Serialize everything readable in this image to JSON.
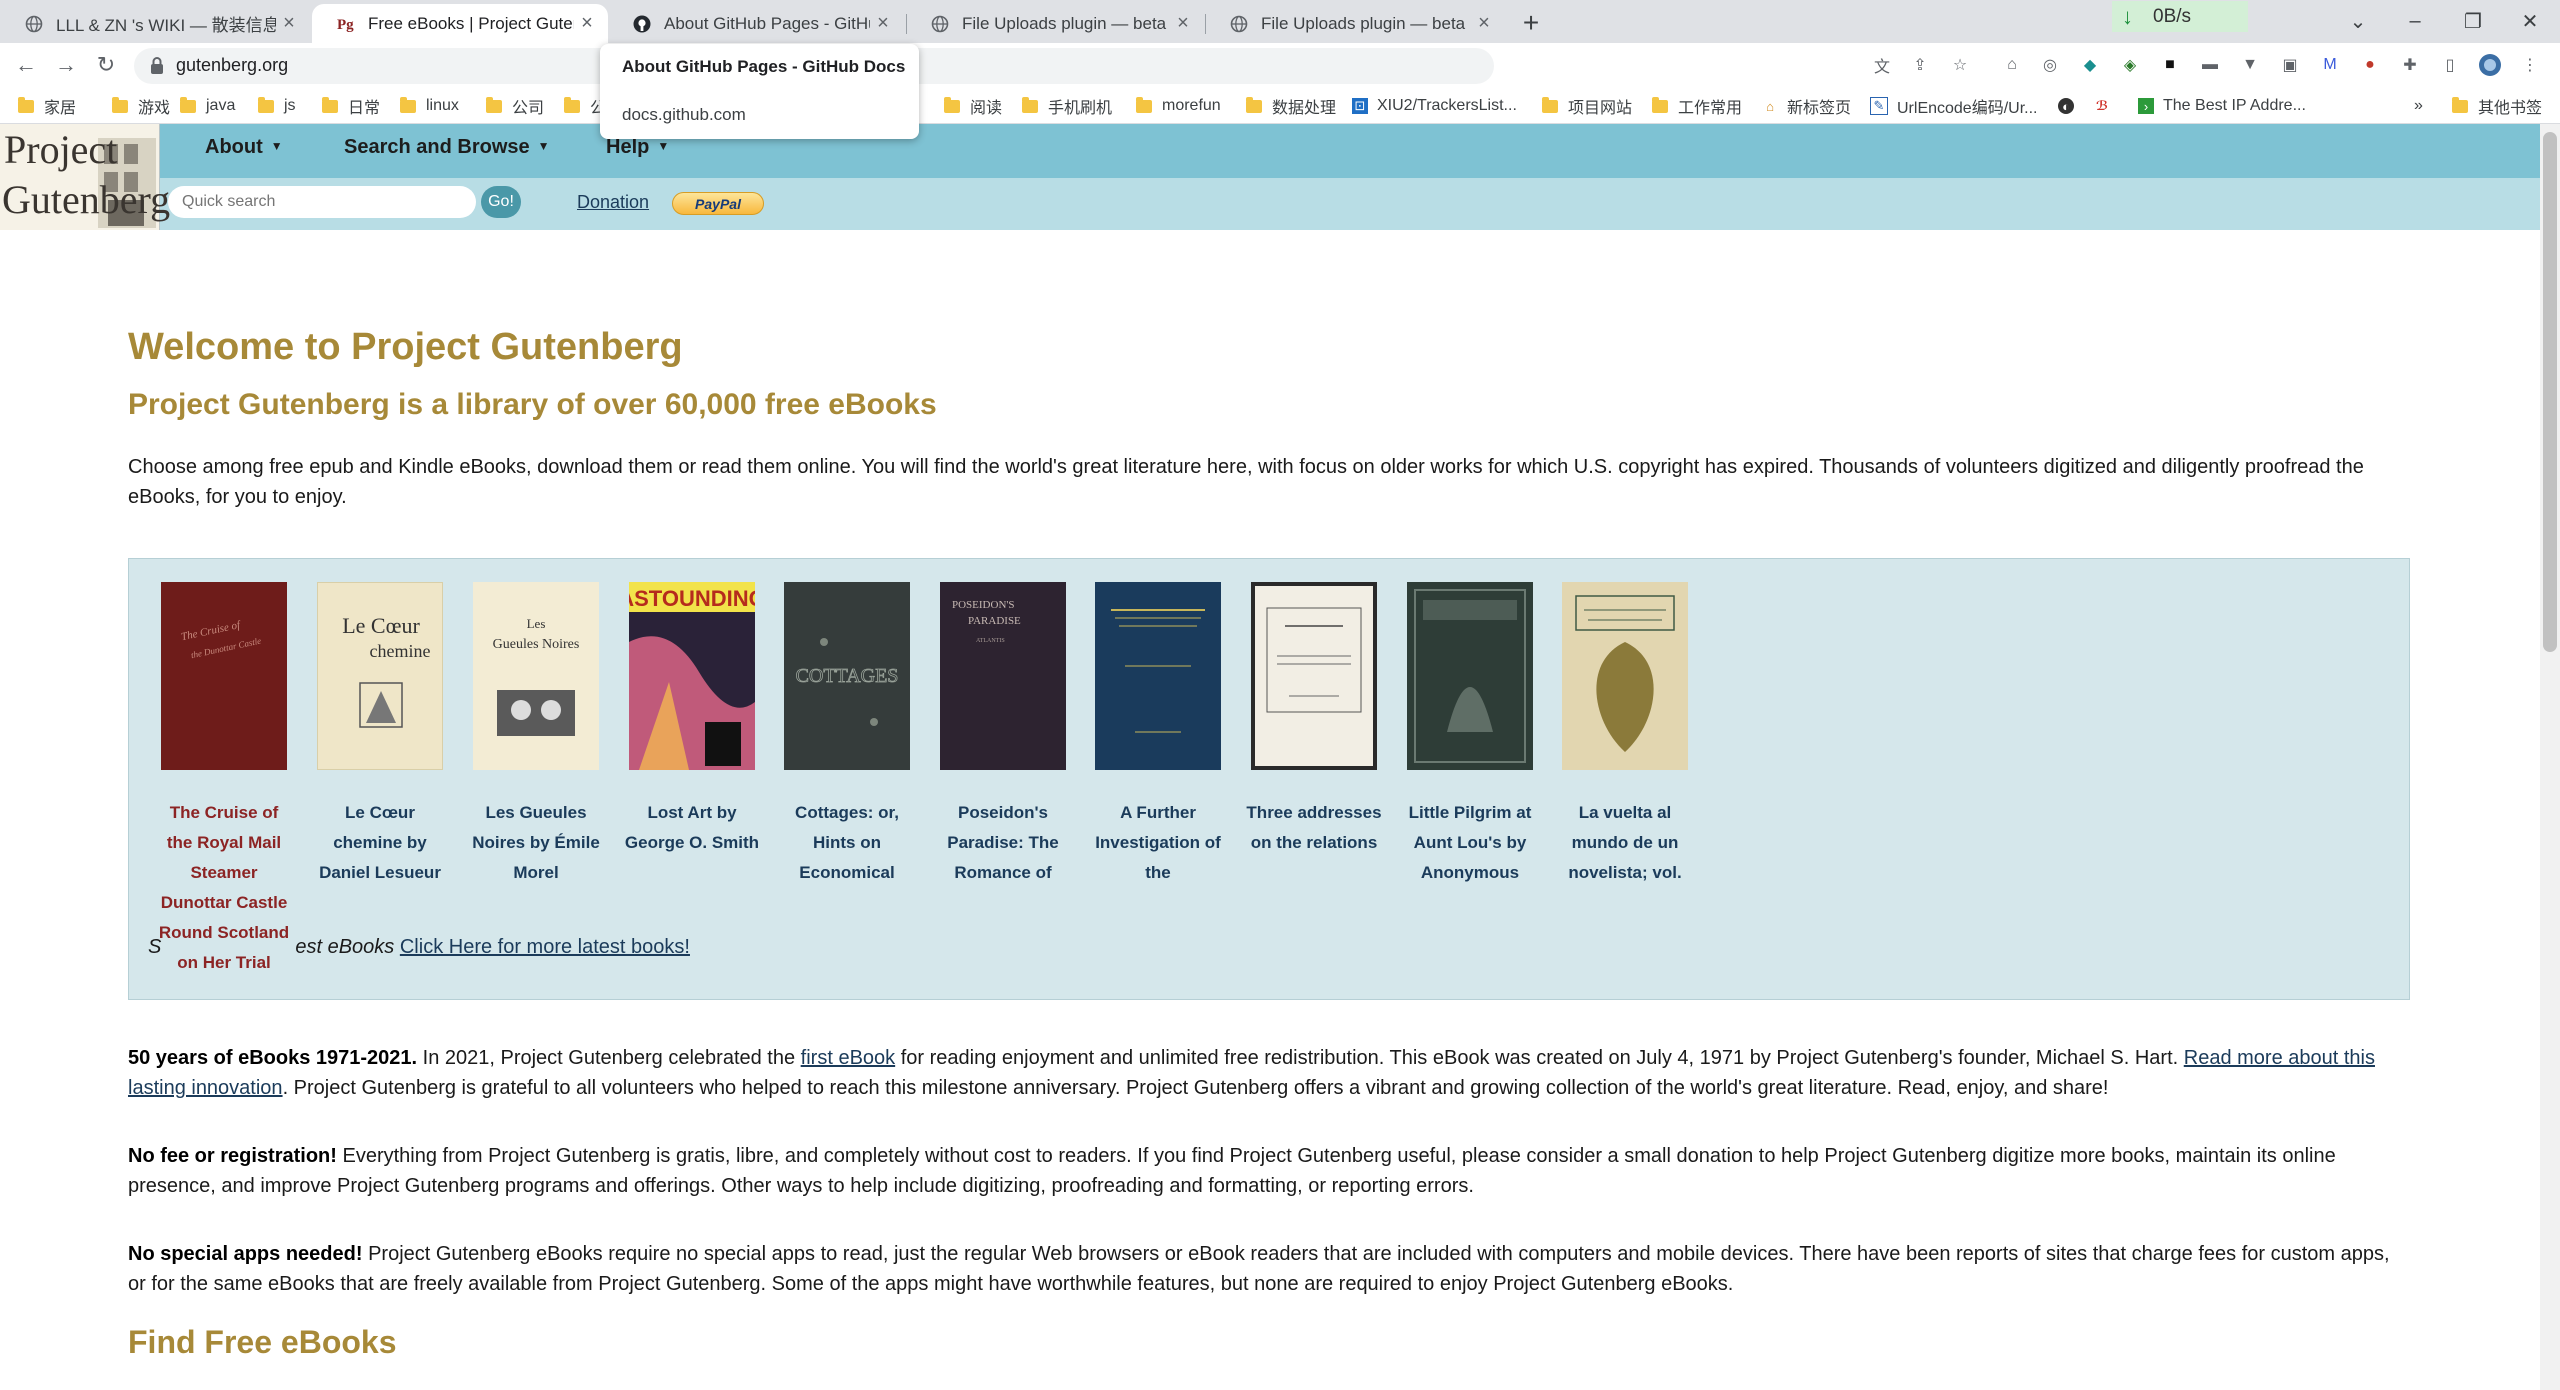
{
  "browser": {
    "tabs": [
      {
        "title": "LLL & ZN 's WIKI — 散装信息系",
        "icon": "globe-icon"
      },
      {
        "title": "Free eBooks | Project Gutenbe",
        "icon": "gutenberg-icon"
      },
      {
        "title": "About GitHub Pages - GitHub",
        "icon": "github-icon"
      },
      {
        "title": "File Uploads plugin — beta",
        "icon": "globe-icon"
      },
      {
        "title": "File Uploads plugin — beta",
        "icon": "globe-icon"
      }
    ],
    "net_speed": "0B/s",
    "url": "gutenberg.org",
    "bookmarks": [
      "家居",
      "游戏",
      "java",
      "js",
      "日常",
      "linux",
      "公司",
      "公",
      "阅读",
      "手机刷机",
      "morefun",
      "数据处理",
      "XIU2/TrackersList...",
      "项目网站",
      "工作常用",
      "新标签页",
      "UrlEncode编码/Ur...",
      "",
      "The Best IP Addre...",
      "其他书签"
    ],
    "tooltip": {
      "title": "About GitHub Pages - GitHub Docs",
      "url": "docs.github.com"
    }
  },
  "site": {
    "logo_line1": "Project",
    "logo_line2": "Gutenberg",
    "menu": [
      "About",
      "Search and Browse",
      "Help"
    ],
    "search_placeholder": "Quick search",
    "go_label": "Go!",
    "donation_label": "Donation",
    "paypal_label": "PayPal"
  },
  "main": {
    "title": "Welcome to Project Gutenberg",
    "subtitle": "Project Gutenberg is a library of over 60,000 free eBooks",
    "intro": "Choose among free epub and Kindle eBooks, download them or read them online. You will find the world's great literature here, with focus on older works for which U.S. copyright has expired. Thousands of volunteers digitized and diligently proofread the eBooks, for you to enjoy.",
    "books": [
      {
        "title": "The Cruise of the Royal Mail Steamer Dunottar Castle Round Scotland on Her Trial",
        "cover_color": "#6e1c1a"
      },
      {
        "title": "Le Cœur chemine by Daniel Lesueur",
        "cover_color": "#efe6c8"
      },
      {
        "title": "Les Gueules Noires by Émile Morel",
        "cover_color": "#f3ecd4"
      },
      {
        "title": "Lost Art by George O. Smith",
        "cover_color": "#2a2238"
      },
      {
        "title": "Cottages: or, Hints on Economical",
        "cover_color": "#353c3b"
      },
      {
        "title": "Poseidon's Paradise: The Romance of",
        "cover_color": "#2d2330"
      },
      {
        "title": "A Further Investigation of the",
        "cover_color": "#1a3b5c"
      },
      {
        "title": "Three addresses on the relations",
        "cover_color": "#f2eee4"
      },
      {
        "title": "Little Pilgrim at Aunt Lou's by Anonymous",
        "cover_color": "#2e3d37"
      },
      {
        "title": "La vuelta al mundo de un novelista; vol.",
        "cover_color": "#e2d6b0"
      }
    ],
    "latest_prefix": "S",
    "latest_text": "est eBooks",
    "latest_link": "Click Here for more latest books!",
    "p1_bold": "50 years of eBooks 1971-2021.",
    "p1_a": " In 2021, Project Gutenberg celebrated the ",
    "p1_link1": "first eBook",
    "p1_b": " for reading enjoyment and unlimited free redistribution. This eBook was created on July 4, 1971 by Project Gutenberg's founder, Michael S. Hart. ",
    "p1_link2": "Read more about this lasting innovation",
    "p1_c": ". Project Gutenberg is grateful to all volunteers who helped to reach this milestone anniversary. Project Gutenberg offers a vibrant and growing collection of the world's great literature. Read, enjoy, and share!",
    "p2_bold": "No fee or registration!",
    "p2_text": " Everything from Project Gutenberg is gratis, libre, and completely without cost to readers. If you find Project Gutenberg useful, please consider a small donation to help Project Gutenberg digitize more books, maintain its online presence, and improve Project Gutenberg programs and offerings. Other ways to help include digitizing, proofreading and formatting, or reporting errors.",
    "p3_bold": "No special apps needed!",
    "p3_text": " Project Gutenberg eBooks require no special apps to read, just the regular Web browsers or eBook readers that are included with computers and mobile devices. There have been reports of sites that charge fees for custom apps, or for the same eBooks that are freely available from Project Gutenberg. Some of the apps might have worthwhile features, but none are required to enjoy Project Gutenberg eBooks.",
    "find_heading": "Find Free eBooks"
  }
}
